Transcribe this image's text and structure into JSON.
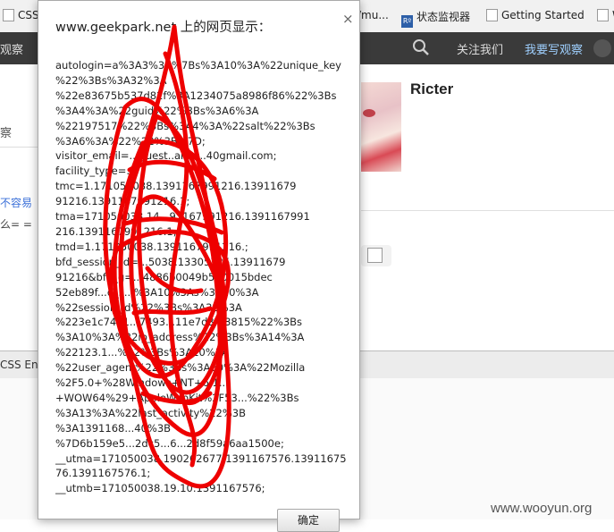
{
  "bookmarks": [
    {
      "label": "CSS",
      "icon": "page-icon"
    },
    {
      "label": "/mu...",
      "icon": "page-icon"
    },
    {
      "label": "状态监视器",
      "icon": "rp-icon"
    },
    {
      "label": "Getting Started",
      "icon": "page-icon"
    },
    {
      "label": "W",
      "icon": "page-icon"
    }
  ],
  "nav": {
    "left_text": "观察",
    "about_label": "关注我们",
    "write_label": "我要写观察"
  },
  "page": {
    "tab_label": "察",
    "left_link": "不容易",
    "left_emoji": "么= =",
    "profile_name": "Ricter"
  },
  "devtools": {
    "tab_label": "CSS Enco"
  },
  "dialog": {
    "title": "www.geekpark.net 上的网页显示：",
    "close_glyph": "×",
    "message_lines": [
      "autologin=a%3A3%3A%7Bs%3A10%3A%22unique_key",
      "%22%3Bs%3A32%3A",
      "%22e83675b537d82f%3A1234075a8986f86%22%3Bs",
      "%3A4%3A%22guid%22%3Bs%3A6%3A",
      "%22197517%22%3Bs%3A4%3A%22salt%22%3Bs",
      "%3A6%3A%22%22%3B%7D;",
      "visitor_email=...guest..anqi...40gmail.com;",
      "facility_type=...",
      "tmc=1.171050038.1391167991216.13911679",
      "91216.1391167991216.1;",
      "tma=171050038.14...91167991216.1391167991",
      "216.1391167991216.1;",
      "tmd=1.171050038.1391167991216.;",
      "bfd_session_id=...5038.13305725.13911679",
      "91216&bfd_g=...4886b0049b560015bdec",
      "52eb89f...d_s...%3A10%3As%3A10%3A",
      "%22session_id%22%3Bs%3A32%3A",
      "%223e1c7431...7493...11e7d3f83815%22%3Bs",
      "%3A10%3A%22ip_address%22%3Bs%3A14%3A",
      "%22123.1...%22%3Bs%3A10%3A",
      "%22user_agent%22%3Bs%3A50%3A%22Mozilla",
      "%2F5.0+%28Windows+NT+6.1...",
      "+WOW64%29+AppleWebKit%2F53...%22%3Bs",
      "%3A13%3A%22last_activity%22%3B",
      "%3A1391168...40%3B",
      "%7D6b159e5...2dc5...6...2d8f59a6aa1500e;",
      "__utma=171050038.190262677.1391167576.13911675",
      "76.1391167576.1;",
      "__utmb=171050038.19.10.1391167576;"
    ],
    "ok_label": "确定"
  },
  "watermark": "www.wooyun.org",
  "colors": {
    "redaction": "#ee0000",
    "nav_background": "#3a3a3a",
    "nav_highlight": "#9fd0ff",
    "link": "#3a6fd8"
  }
}
